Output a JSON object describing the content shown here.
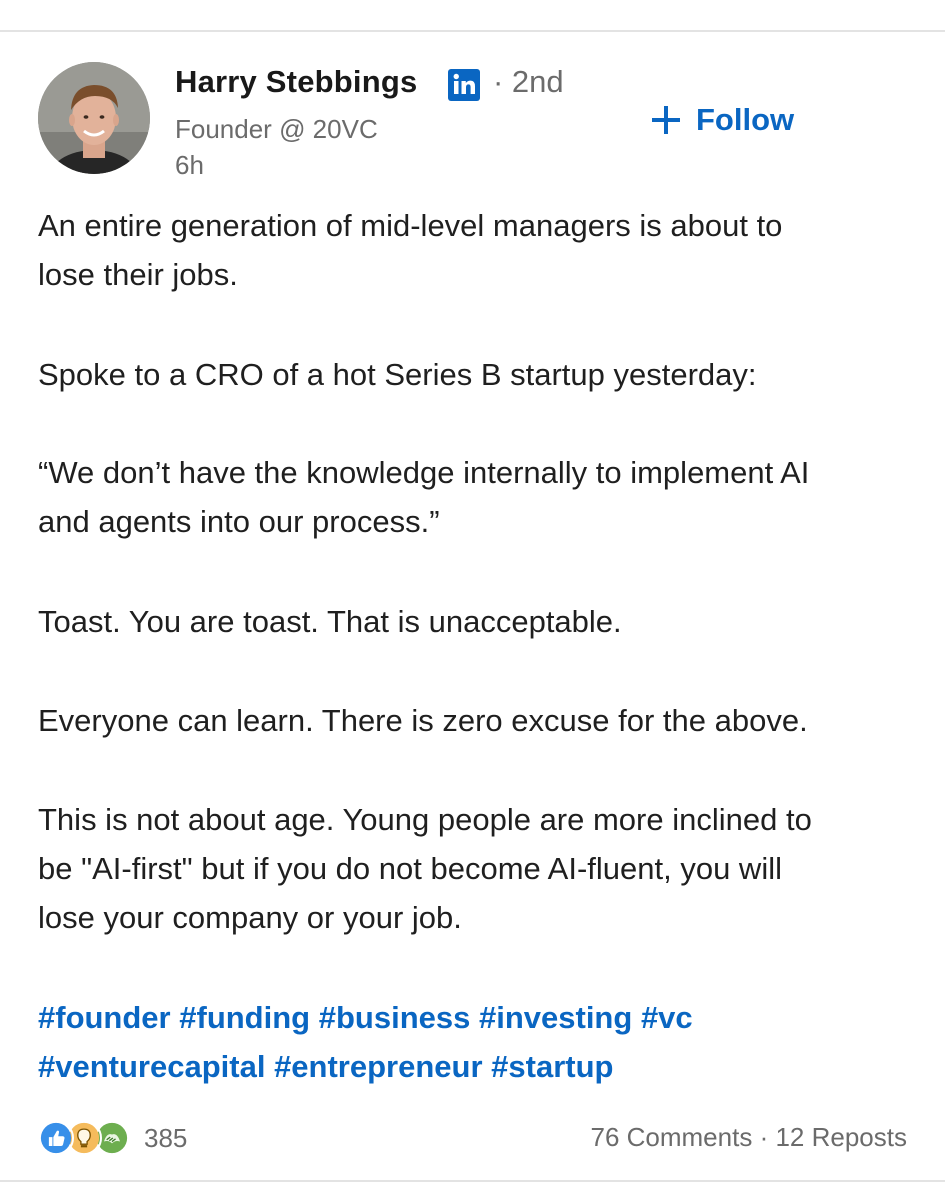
{
  "post": {
    "author": {
      "name": "Harry Stebbings",
      "degree": "· 2nd",
      "headline": "Founder @ 20VC",
      "time": "6h"
    },
    "follow_label": "Follow",
    "paragraphs": [
      [
        "An entire generation of mid-level managers is about to",
        "lose their jobs."
      ],
      [
        "Spoke to a CRO of a hot Series B startup yesterday:"
      ],
      [
        "“We don’t have the knowledge internally to implement AI",
        "and agents into our process.”"
      ],
      [
        "Toast. You are toast. That is unacceptable."
      ],
      [
        "Everyone can learn. There is zero excuse for the above."
      ],
      [
        "This is not about age. Young people are more inclined to",
        "be \"AI-first\" but if you do not become AI-fluent, you will",
        "lose your company or your job."
      ]
    ],
    "hashtags": [
      [
        "#founder",
        "#funding",
        "#business",
        "#investing",
        "#vc"
      ],
      [
        "#venturecapital",
        "#entrepreneur",
        "#startup"
      ]
    ],
    "reactions": {
      "icons": [
        "like-icon",
        "insightful-icon",
        "support-icon"
      ],
      "count": "385"
    },
    "comments": "76 Comments",
    "separator": "·",
    "reposts": "12 Reposts"
  },
  "colors": {
    "accent": "#0a66c2",
    "muted": "#6b6b6b",
    "text": "#1f1f1f"
  }
}
